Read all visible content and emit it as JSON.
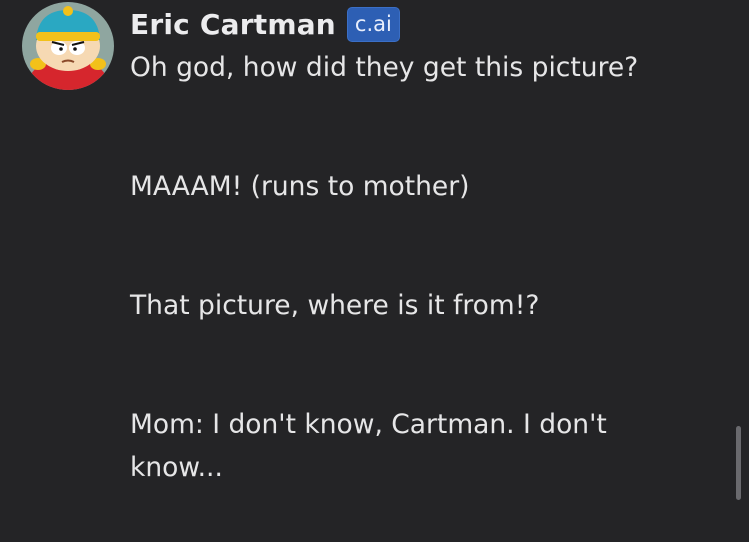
{
  "message": {
    "author": "Eric Cartman",
    "badge": "c.ai",
    "paragraphs": [
      "Oh god, how did they get this picture?",
      "MAAAM! (runs to mother)",
      "That picture, where is it from!?",
      "Mom: I don't know, Cartman. I don't know..."
    ]
  },
  "colors": {
    "background": "#242426",
    "text": "#e6e6e7",
    "badge_bg": "#2d5fb4"
  },
  "icons": {
    "avatar": "cartman-avatar",
    "scrollbar": "scrollbar-thumb"
  }
}
